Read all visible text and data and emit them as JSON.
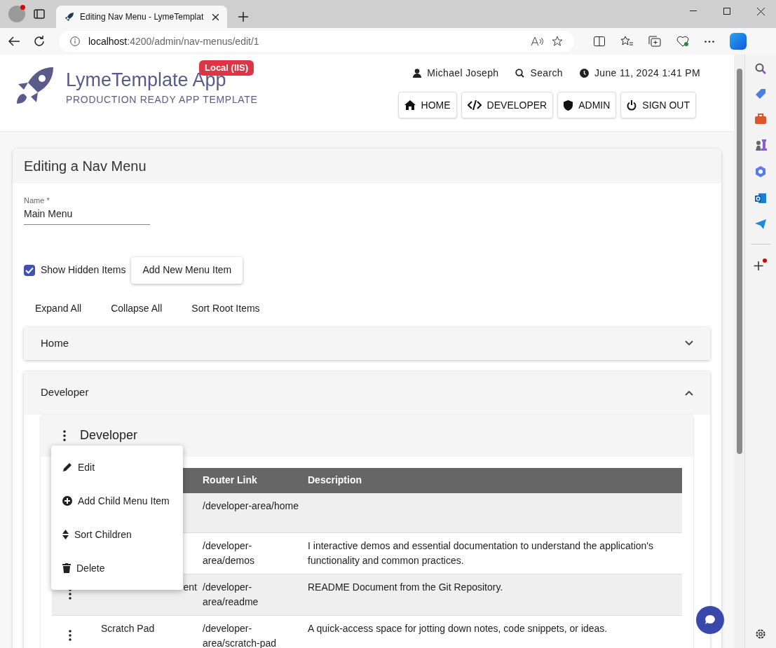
{
  "browser": {
    "tab_title": "Editing Nav Menu - LymeTemplat",
    "url_host": "localhost",
    "url_path": ":4200/admin/nav-menus/edit/1"
  },
  "header": {
    "app_name": "LymeTemplate App",
    "subtitle": "PRODUCTION READY APP TEMPLATE",
    "env_badge": "Local (IIS)",
    "user": "Michael Joseph",
    "search": "Search",
    "datetime": "June 11, 2024 1:41 PM",
    "nav": [
      {
        "label": "HOME",
        "kind": "home"
      },
      {
        "label": "DEVELOPER",
        "kind": "code"
      },
      {
        "label": "ADMIN",
        "kind": "shield"
      },
      {
        "label": "SIGN OUT",
        "kind": "power"
      }
    ]
  },
  "card": {
    "title": "Editing a Nav Menu",
    "name_field": {
      "label": "Name *",
      "value": "Main Menu"
    },
    "show_hidden": {
      "label": "Show Hidden Items",
      "checked": true
    },
    "add_button": "Add New Menu Item",
    "actions": [
      "Expand All",
      "Collapse All",
      "Sort Root Items"
    ],
    "panels": [
      {
        "title": "Home",
        "expanded": false
      },
      {
        "title": "Developer",
        "expanded": true
      }
    ],
    "sub_panel": {
      "title": "Developer"
    },
    "table": {
      "columns": [
        "Router Link",
        "Description"
      ],
      "rows": [
        {
          "link": "/developer-area/home"
        },
        {
          "link": "/developer-area/demos",
          "description": "I interactive demos and essential documentation to understand the application's functionality and common practices."
        },
        {
          "name": "ent",
          "name_cut_left": true,
          "link": "/developer-area/readme",
          "description": "README Document from the Git Repository."
        },
        {
          "name": "Scratch Pad",
          "link": "/developer-area/scratch-pad",
          "description": "A quick-access space for jotting down notes, code snippets, or ideas."
        }
      ]
    },
    "context_menu": [
      {
        "label": "Edit",
        "kind": "edit"
      },
      {
        "label": "Add Child Menu Item",
        "kind": "add"
      },
      {
        "label": "Sort Children",
        "kind": "sort"
      },
      {
        "label": "Delete",
        "kind": "delete"
      }
    ]
  }
}
